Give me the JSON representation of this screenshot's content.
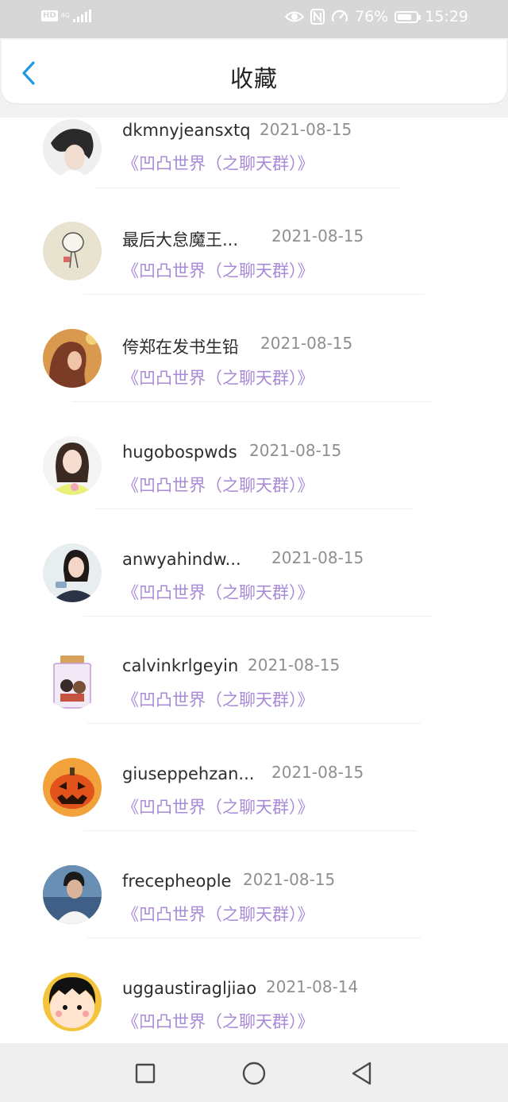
{
  "status_bar": {
    "hd_label": "HD",
    "network_label": "4G",
    "battery_text": "76%",
    "battery_level": 0.76,
    "time": "15:29"
  },
  "header": {
    "title": "收藏",
    "back_icon": "chevron-left-icon"
  },
  "favorites": [
    {
      "username": "dkmnyjeansxtq",
      "date": "2021-08-15",
      "group": "《凹凸世界（之聊天群）》"
    },
    {
      "username": "最后大怠魔王...",
      "date": "2021-08-15",
      "group": "《凹凸世界（之聊天群）》"
    },
    {
      "username": "侉郑在发书生铅",
      "date": "2021-08-15",
      "group": "《凹凸世界（之聊天群）》"
    },
    {
      "username": "hugobospwds",
      "date": "2021-08-15",
      "group": "《凹凸世界（之聊天群）》"
    },
    {
      "username": "anwyahindw...",
      "date": "2021-08-15",
      "group": "《凹凸世界（之聊天群）》"
    },
    {
      "username": "calvinkrlgeyin",
      "date": "2021-08-15",
      "group": "《凹凸世界（之聊天群）》"
    },
    {
      "username": "giuseppehzan...",
      "date": "2021-08-15",
      "group": "《凹凸世界（之聊天群）》"
    },
    {
      "username": "frecepheople",
      "date": "2021-08-15",
      "group": "《凹凸世界（之聊天群）》"
    },
    {
      "username": "uggaustiragljiao",
      "date": "2021-08-14",
      "group": "《凹凸世界（之聊天群）》"
    }
  ],
  "colors": {
    "group_link": "#a88ad8",
    "back_icon": "#1e9be0"
  },
  "nav_bar": {
    "icons": [
      "square-recents-icon",
      "circle-home-icon",
      "triangle-back-icon"
    ]
  }
}
